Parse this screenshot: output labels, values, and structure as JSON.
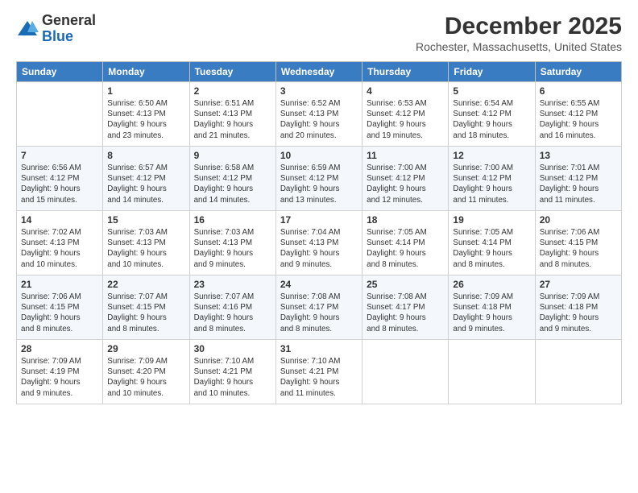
{
  "app": {
    "logo_general": "General",
    "logo_blue": "Blue"
  },
  "header": {
    "month_year": "December 2025",
    "location": "Rochester, Massachusetts, United States"
  },
  "weekdays": [
    "Sunday",
    "Monday",
    "Tuesday",
    "Wednesday",
    "Thursday",
    "Friday",
    "Saturday"
  ],
  "weeks": [
    [
      {
        "day": "",
        "info": ""
      },
      {
        "day": "1",
        "info": "Sunrise: 6:50 AM\nSunset: 4:13 PM\nDaylight: 9 hours\nand 23 minutes."
      },
      {
        "day": "2",
        "info": "Sunrise: 6:51 AM\nSunset: 4:13 PM\nDaylight: 9 hours\nand 21 minutes."
      },
      {
        "day": "3",
        "info": "Sunrise: 6:52 AM\nSunset: 4:13 PM\nDaylight: 9 hours\nand 20 minutes."
      },
      {
        "day": "4",
        "info": "Sunrise: 6:53 AM\nSunset: 4:12 PM\nDaylight: 9 hours\nand 19 minutes."
      },
      {
        "day": "5",
        "info": "Sunrise: 6:54 AM\nSunset: 4:12 PM\nDaylight: 9 hours\nand 18 minutes."
      },
      {
        "day": "6",
        "info": "Sunrise: 6:55 AM\nSunset: 4:12 PM\nDaylight: 9 hours\nand 16 minutes."
      }
    ],
    [
      {
        "day": "7",
        "info": "Sunrise: 6:56 AM\nSunset: 4:12 PM\nDaylight: 9 hours\nand 15 minutes."
      },
      {
        "day": "8",
        "info": "Sunrise: 6:57 AM\nSunset: 4:12 PM\nDaylight: 9 hours\nand 14 minutes."
      },
      {
        "day": "9",
        "info": "Sunrise: 6:58 AM\nSunset: 4:12 PM\nDaylight: 9 hours\nand 14 minutes."
      },
      {
        "day": "10",
        "info": "Sunrise: 6:59 AM\nSunset: 4:12 PM\nDaylight: 9 hours\nand 13 minutes."
      },
      {
        "day": "11",
        "info": "Sunrise: 7:00 AM\nSunset: 4:12 PM\nDaylight: 9 hours\nand 12 minutes."
      },
      {
        "day": "12",
        "info": "Sunrise: 7:00 AM\nSunset: 4:12 PM\nDaylight: 9 hours\nand 11 minutes."
      },
      {
        "day": "13",
        "info": "Sunrise: 7:01 AM\nSunset: 4:12 PM\nDaylight: 9 hours\nand 11 minutes."
      }
    ],
    [
      {
        "day": "14",
        "info": "Sunrise: 7:02 AM\nSunset: 4:13 PM\nDaylight: 9 hours\nand 10 minutes."
      },
      {
        "day": "15",
        "info": "Sunrise: 7:03 AM\nSunset: 4:13 PM\nDaylight: 9 hours\nand 10 minutes."
      },
      {
        "day": "16",
        "info": "Sunrise: 7:03 AM\nSunset: 4:13 PM\nDaylight: 9 hours\nand 9 minutes."
      },
      {
        "day": "17",
        "info": "Sunrise: 7:04 AM\nSunset: 4:13 PM\nDaylight: 9 hours\nand 9 minutes."
      },
      {
        "day": "18",
        "info": "Sunrise: 7:05 AM\nSunset: 4:14 PM\nDaylight: 9 hours\nand 8 minutes."
      },
      {
        "day": "19",
        "info": "Sunrise: 7:05 AM\nSunset: 4:14 PM\nDaylight: 9 hours\nand 8 minutes."
      },
      {
        "day": "20",
        "info": "Sunrise: 7:06 AM\nSunset: 4:15 PM\nDaylight: 9 hours\nand 8 minutes."
      }
    ],
    [
      {
        "day": "21",
        "info": "Sunrise: 7:06 AM\nSunset: 4:15 PM\nDaylight: 9 hours\nand 8 minutes."
      },
      {
        "day": "22",
        "info": "Sunrise: 7:07 AM\nSunset: 4:15 PM\nDaylight: 9 hours\nand 8 minutes."
      },
      {
        "day": "23",
        "info": "Sunrise: 7:07 AM\nSunset: 4:16 PM\nDaylight: 9 hours\nand 8 minutes."
      },
      {
        "day": "24",
        "info": "Sunrise: 7:08 AM\nSunset: 4:17 PM\nDaylight: 9 hours\nand 8 minutes."
      },
      {
        "day": "25",
        "info": "Sunrise: 7:08 AM\nSunset: 4:17 PM\nDaylight: 9 hours\nand 8 minutes."
      },
      {
        "day": "26",
        "info": "Sunrise: 7:09 AM\nSunset: 4:18 PM\nDaylight: 9 hours\nand 9 minutes."
      },
      {
        "day": "27",
        "info": "Sunrise: 7:09 AM\nSunset: 4:18 PM\nDaylight: 9 hours\nand 9 minutes."
      }
    ],
    [
      {
        "day": "28",
        "info": "Sunrise: 7:09 AM\nSunset: 4:19 PM\nDaylight: 9 hours\nand 9 minutes."
      },
      {
        "day": "29",
        "info": "Sunrise: 7:09 AM\nSunset: 4:20 PM\nDaylight: 9 hours\nand 10 minutes."
      },
      {
        "day": "30",
        "info": "Sunrise: 7:10 AM\nSunset: 4:21 PM\nDaylight: 9 hours\nand 10 minutes."
      },
      {
        "day": "31",
        "info": "Sunrise: 7:10 AM\nSunset: 4:21 PM\nDaylight: 9 hours\nand 11 minutes."
      },
      {
        "day": "",
        "info": ""
      },
      {
        "day": "",
        "info": ""
      },
      {
        "day": "",
        "info": ""
      }
    ]
  ]
}
